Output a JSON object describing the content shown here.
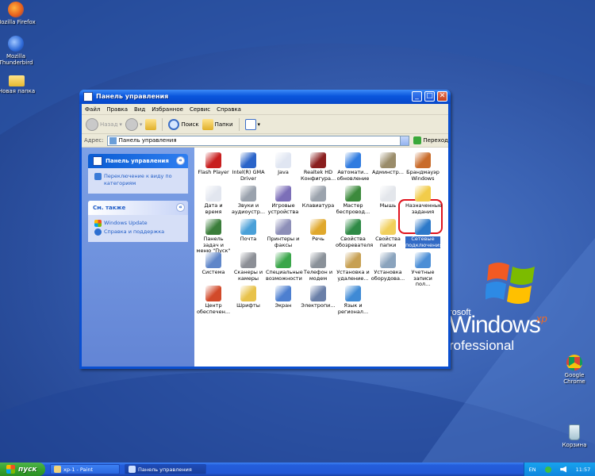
{
  "desktop": {
    "icons": [
      {
        "label": "Mozilla Firefox",
        "icon": "firefox-icon"
      },
      {
        "label": "Mozilla Thunderbird",
        "icon": "thunderbird-icon"
      },
      {
        "label": "Новая папка",
        "icon": "folder-icon"
      },
      {
        "label": "Google Chrome",
        "icon": "chrome-icon"
      },
      {
        "label": "Корзина",
        "icon": "recycle-bin-icon"
      }
    ],
    "logo": {
      "pre": "rosoft",
      "word": "Windows",
      "xp": "xp",
      "edition": "rofessional"
    }
  },
  "window": {
    "title": "Панель управления",
    "menu": [
      "Файл",
      "Правка",
      "Вид",
      "Избранное",
      "Сервис",
      "Справка"
    ],
    "toolbar": {
      "back": "Назад",
      "search": "Поиск",
      "folders": "Папки"
    },
    "address": {
      "label": "Адрес:",
      "value": "Панель управления",
      "go": "Переход"
    },
    "side": {
      "panel_title": "Панель управления",
      "switch_view": "Переключение к виду по категориям",
      "see_also_title": "См. также",
      "links": [
        "Windows Update",
        "Справка и поддержка"
      ]
    },
    "items": [
      {
        "label": "Flash Player",
        "icon": "flash-icon"
      },
      {
        "label": "Intel(R) GMA Driver",
        "icon": "intel-gma-icon"
      },
      {
        "label": "Java",
        "icon": "java-icon"
      },
      {
        "label": "Realtek HD Конфигура...",
        "icon": "speaker-icon"
      },
      {
        "label": "Автомати... обновление",
        "icon": "auto-update-icon"
      },
      {
        "label": "Админстр...",
        "icon": "admin-tools-icon"
      },
      {
        "label": "Брандмауэр Windows",
        "icon": "firewall-icon"
      },
      {
        "label": "Дата и время",
        "icon": "clock-icon"
      },
      {
        "label": "Звуки и аудиоустр...",
        "icon": "sound-icon"
      },
      {
        "label": "Игровые устройства",
        "icon": "gamepad-icon"
      },
      {
        "label": "Клавиатура",
        "icon": "keyboard-icon"
      },
      {
        "label": "Мастер беспровод...",
        "icon": "wireless-wizard-icon"
      },
      {
        "label": "Мышь",
        "icon": "mouse-icon"
      },
      {
        "label": "Назначенные задания",
        "icon": "scheduled-tasks-icon"
      },
      {
        "label": "Панель задач и меню \"Пуск\"",
        "icon": "taskbar-icon"
      },
      {
        "label": "Почта",
        "icon": "mail-icon"
      },
      {
        "label": "Принтеры и факсы",
        "icon": "printer-icon"
      },
      {
        "label": "Речь",
        "icon": "speech-icon"
      },
      {
        "label": "Свойства обозревателя",
        "icon": "internet-options-icon"
      },
      {
        "label": "Свойства папки",
        "icon": "folder-options-icon"
      },
      {
        "label": "Сетевые подключения",
        "icon": "network-connections-icon"
      },
      {
        "label": "Система",
        "icon": "system-icon"
      },
      {
        "label": "Сканеры и камеры",
        "icon": "scanner-icon"
      },
      {
        "label": "Специальные возможности",
        "icon": "accessibility-icon"
      },
      {
        "label": "Телефон и модем",
        "icon": "phone-modem-icon"
      },
      {
        "label": "Установка и удаление...",
        "icon": "add-remove-icon"
      },
      {
        "label": "Установка оборудова...",
        "icon": "hardware-icon"
      },
      {
        "label": "Учетные записи пол...",
        "icon": "user-accounts-icon"
      },
      {
        "label": "Центр обеспечен...",
        "icon": "security-center-icon"
      },
      {
        "label": "Шрифты",
        "icon": "fonts-icon"
      },
      {
        "label": "Экран",
        "icon": "display-icon"
      },
      {
        "label": "Электропи...",
        "icon": "power-icon"
      },
      {
        "label": "Язык и регионал...",
        "icon": "language-icon"
      }
    ]
  },
  "taskbar": {
    "start": "пуск",
    "items": [
      {
        "label": "xp-1 - Paint"
      },
      {
        "label": "Панель управления"
      }
    ],
    "lang": "EN",
    "clock": "11:57"
  }
}
